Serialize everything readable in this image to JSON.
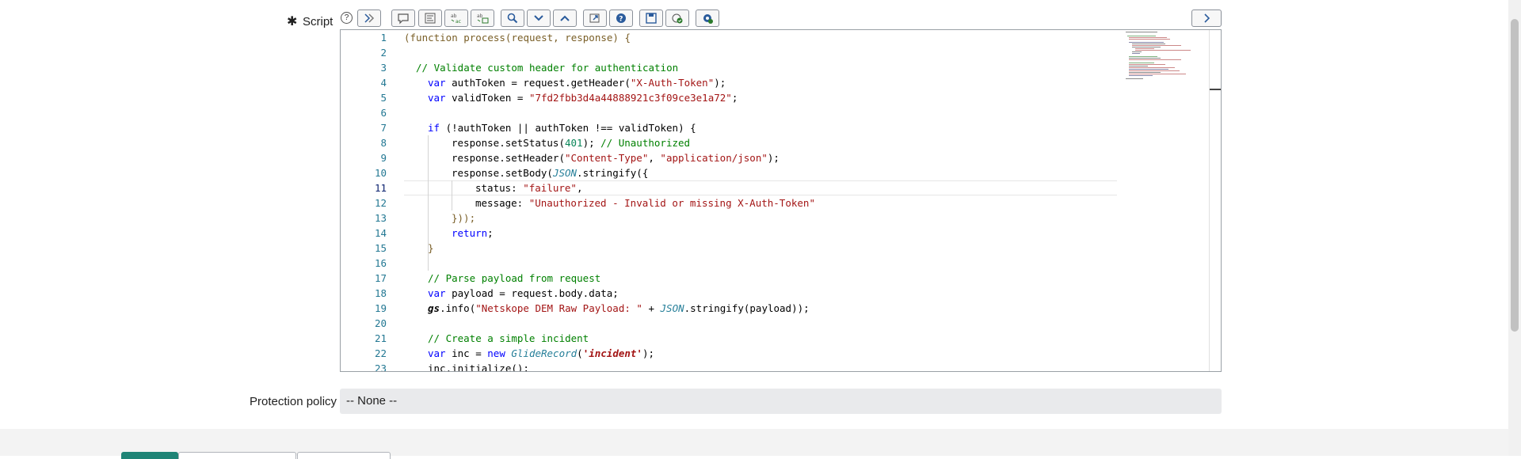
{
  "form": {
    "script_required_marker": "✱",
    "script_label": "Script",
    "help_icon_glyph": "?",
    "protection_label": "Protection policy",
    "protection_value": "-- None --"
  },
  "toolbar": {
    "buttons": [
      "toggle-syntax",
      "comment",
      "format",
      "replace",
      "replace-all",
      "search",
      "next",
      "previous",
      "fullscreen",
      "help",
      "save",
      "script-debugger",
      "debug"
    ],
    "expand_label": "›"
  },
  "code": {
    "line_numbers": [
      "1",
      "2",
      "3",
      "4",
      "5",
      "6",
      "7",
      "8",
      "9",
      "10",
      "11",
      "12",
      "13",
      "14",
      "15",
      "16",
      "17",
      "18",
      "19",
      "20",
      "21",
      "22",
      "23"
    ],
    "current_line": "11",
    "lines": {
      "l1": "(function process(request, response) {",
      "l3": "// Validate custom header for authentication",
      "l4a": "var",
      "l4b": " authToken = request.getHeader(",
      "l4c": "\"X-Auth-Token\"",
      "l4d": ");",
      "l5a": "var",
      "l5b": " validToken = ",
      "l5c": "\"7fd2fbb3d4a44888921c3f09ce3e1a72\"",
      "l5d": ";",
      "l7a": "if",
      "l7b": " (!authToken || authToken !== validToken) {",
      "l8a": "response.setStatus(",
      "l8b": "401",
      "l8c": "); ",
      "l8d": "// Unauthorized",
      "l9a": "response.setHeader(",
      "l9b": "\"Content-Type\"",
      "l9c": ", ",
      "l9d": "\"application/json\"",
      "l9e": ");",
      "l10a": "response.setBody(",
      "l10b": "JSON",
      "l10c": ".stringify({",
      "l11a": "status: ",
      "l11b": "\"failure\"",
      "l11c": ",",
      "l12a": "message: ",
      "l12b": "\"Unauthorized - Invalid or missing X-Auth-Token\"",
      "l13": "}));",
      "l14a": "return",
      "l14b": ";",
      "l15": "}",
      "l17": "// Parse payload from request",
      "l18a": "var",
      "l18b": " payload = request.body.data;",
      "l19a": "gs",
      "l19b": ".info(",
      "l19c": "\"Netskope DEM Raw Payload: \"",
      "l19d": " + ",
      "l19e": "JSON",
      "l19f": ".stringify(payload));",
      "l21": "// Create a simple incident",
      "l22a": "var",
      "l22b": " inc = ",
      "l22c": "new",
      "l22d": " ",
      "l22e": "GlideRecord",
      "l22f": "(",
      "l22g": "'incident'",
      "l22h": ");",
      "l23": "inc.initialize();"
    }
  },
  "colors": {
    "keyword": "#0000ff",
    "string": "#a31515",
    "comment": "#008000",
    "number": "#098658",
    "line_number": "#237893"
  }
}
